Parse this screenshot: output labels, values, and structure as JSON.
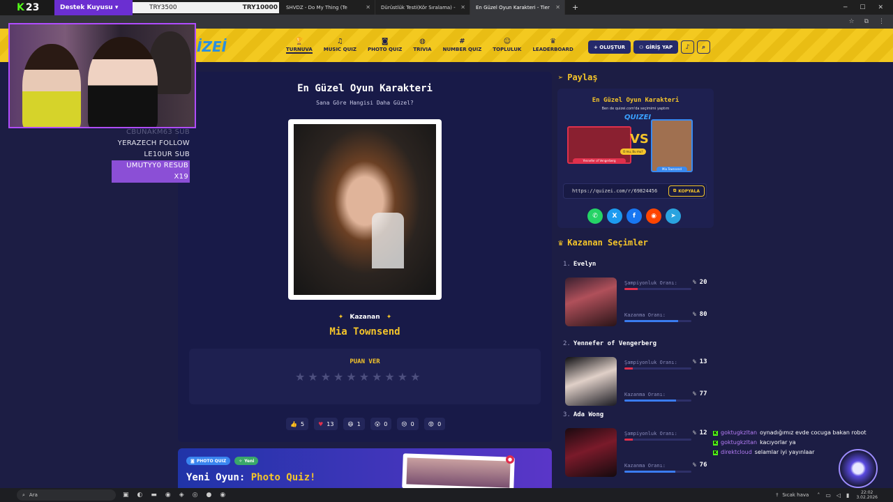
{
  "browser": {
    "tabs": [
      {
        "label": "SHVDZ - Do My Thing (Te",
        "active": false
      },
      {
        "label": "Dürüstlük Testi(Kör Sıralama) - ",
        "active": false
      },
      {
        "label": "En Güzel Oyun Karakteri - Tier",
        "active": true
      }
    ],
    "new_tab": "+"
  },
  "stream": {
    "kick_count": "23",
    "goal_label": "Destek Kuyusu ▾",
    "goal_current": "TRY3500",
    "goal_target": "TRY10000",
    "alerts": [
      {
        "text": "CBUNAKM63 SUB",
        "style": "faded"
      },
      {
        "text": "YERAZECH FOLLOW",
        "style": "normal"
      },
      {
        "text": "LE10UR SUB",
        "style": "normal"
      },
      {
        "text": "UMUTYY0 RESUB X19",
        "style": "highlight"
      }
    ],
    "chat": [
      {
        "user": "goktugkzltan",
        "msg": "oynadığımız evde cocuga bakan robot"
      },
      {
        "user": "goktugkzltan",
        "msg": "kacıyorlar ya"
      },
      {
        "user": "direktcloud",
        "msg": "selamlar iyi yayınlaar"
      }
    ]
  },
  "site": {
    "brand": "İZEİ",
    "nav": [
      {
        "label": "TURNUVA",
        "icon": "trophy-icon",
        "glyph": "🏆",
        "active": true
      },
      {
        "label": "MUSIC QUIZ",
        "icon": "music-icon",
        "glyph": "♫",
        "active": false
      },
      {
        "label": "PHOTO QUIZ",
        "icon": "camera-icon",
        "glyph": "◙",
        "active": false
      },
      {
        "label": "TRIVIA",
        "icon": "chat-icon",
        "glyph": "◍",
        "active": false
      },
      {
        "label": "NUMBER QUIZ",
        "icon": "hash-icon",
        "glyph": "#",
        "active": false
      },
      {
        "label": "TOPLULUK",
        "icon": "users-icon",
        "glyph": "☺",
        "active": false
      },
      {
        "label": "LEADERBOARD",
        "icon": "award-icon",
        "glyph": "♛",
        "active": false
      }
    ],
    "create_label": "+ OLUŞTUR",
    "login_label": "GİRİŞ YAP"
  },
  "quiz": {
    "title": "En Güzel Oyun Karakteri",
    "subtitle": "Sana Göre Hangisi Daha Güzel?",
    "winner_label": "Kazanan",
    "winner_name": "Mia Townsend",
    "rate_title": "PUAN VER",
    "star_count": 10,
    "reactions": [
      {
        "icon": "thumbs-up-icon",
        "glyph": "👍",
        "count": "5"
      },
      {
        "icon": "heart-icon",
        "glyph": "♥",
        "count": "13"
      },
      {
        "icon": "laugh-icon",
        "glyph": "😆",
        "count": "1"
      },
      {
        "icon": "wow-icon",
        "glyph": "😮",
        "count": "0"
      },
      {
        "icon": "sad-icon",
        "glyph": "😢",
        "count": "0"
      },
      {
        "icon": "angry-icon",
        "glyph": "😡",
        "count": "0"
      }
    ]
  },
  "promo": {
    "badge1": "PHOTO QUIZ",
    "badge2": "Yeni",
    "title_prefix": "Yeni Oyun:",
    "title_highlight": "Photo Quiz!"
  },
  "share": {
    "heading": "Paylaş",
    "card_title": "En Güzel Oyun Karakteri",
    "card_sub": "Ben de quizei.com'da seçimimi yaptım",
    "card_logo": "QUIZEI",
    "vs": "VS",
    "bubble": "O mu, Bu mu?",
    "left_label": "Yennefer of Vengerberg",
    "right_label": "Mia Townsend",
    "url": "https://quizei.com/r/69824456",
    "copy_label": "KOPYALA",
    "socials": [
      {
        "icon": "whatsapp-icon",
        "glyph": "✆",
        "color": "#25d366"
      },
      {
        "icon": "x-icon",
        "glyph": "X",
        "color": "#1d9bf0"
      },
      {
        "icon": "facebook-icon",
        "glyph": "f",
        "color": "#1877f2"
      },
      {
        "icon": "reddit-icon",
        "glyph": "◉",
        "color": "#ff4500"
      },
      {
        "icon": "telegram-icon",
        "glyph": "➤",
        "color": "#2aa3df"
      }
    ]
  },
  "winners": {
    "heading": "Kazanan Seçimler",
    "champ_label": "Şampiyonluk Oranı:",
    "win_label": "Kazanma Oranı:",
    "pct": "%",
    "items": [
      {
        "rank": "1.",
        "name": "Evelyn",
        "champ": "20",
        "win": "80"
      },
      {
        "rank": "2.",
        "name": "Yennefer of Vengerberg",
        "champ": "13",
        "win": "77"
      },
      {
        "rank": "3.",
        "name": "Ada Wong",
        "champ": "12",
        "win": "76"
      }
    ]
  },
  "taskbar": {
    "search": "Ara",
    "weather": "Sıcak hava",
    "time": "22:02",
    "date": "3.02.2026"
  },
  "colors": {
    "accent_yellow": "#f5c52a",
    "bg_navy": "#1c1d44",
    "kick_green": "#53fc18"
  }
}
